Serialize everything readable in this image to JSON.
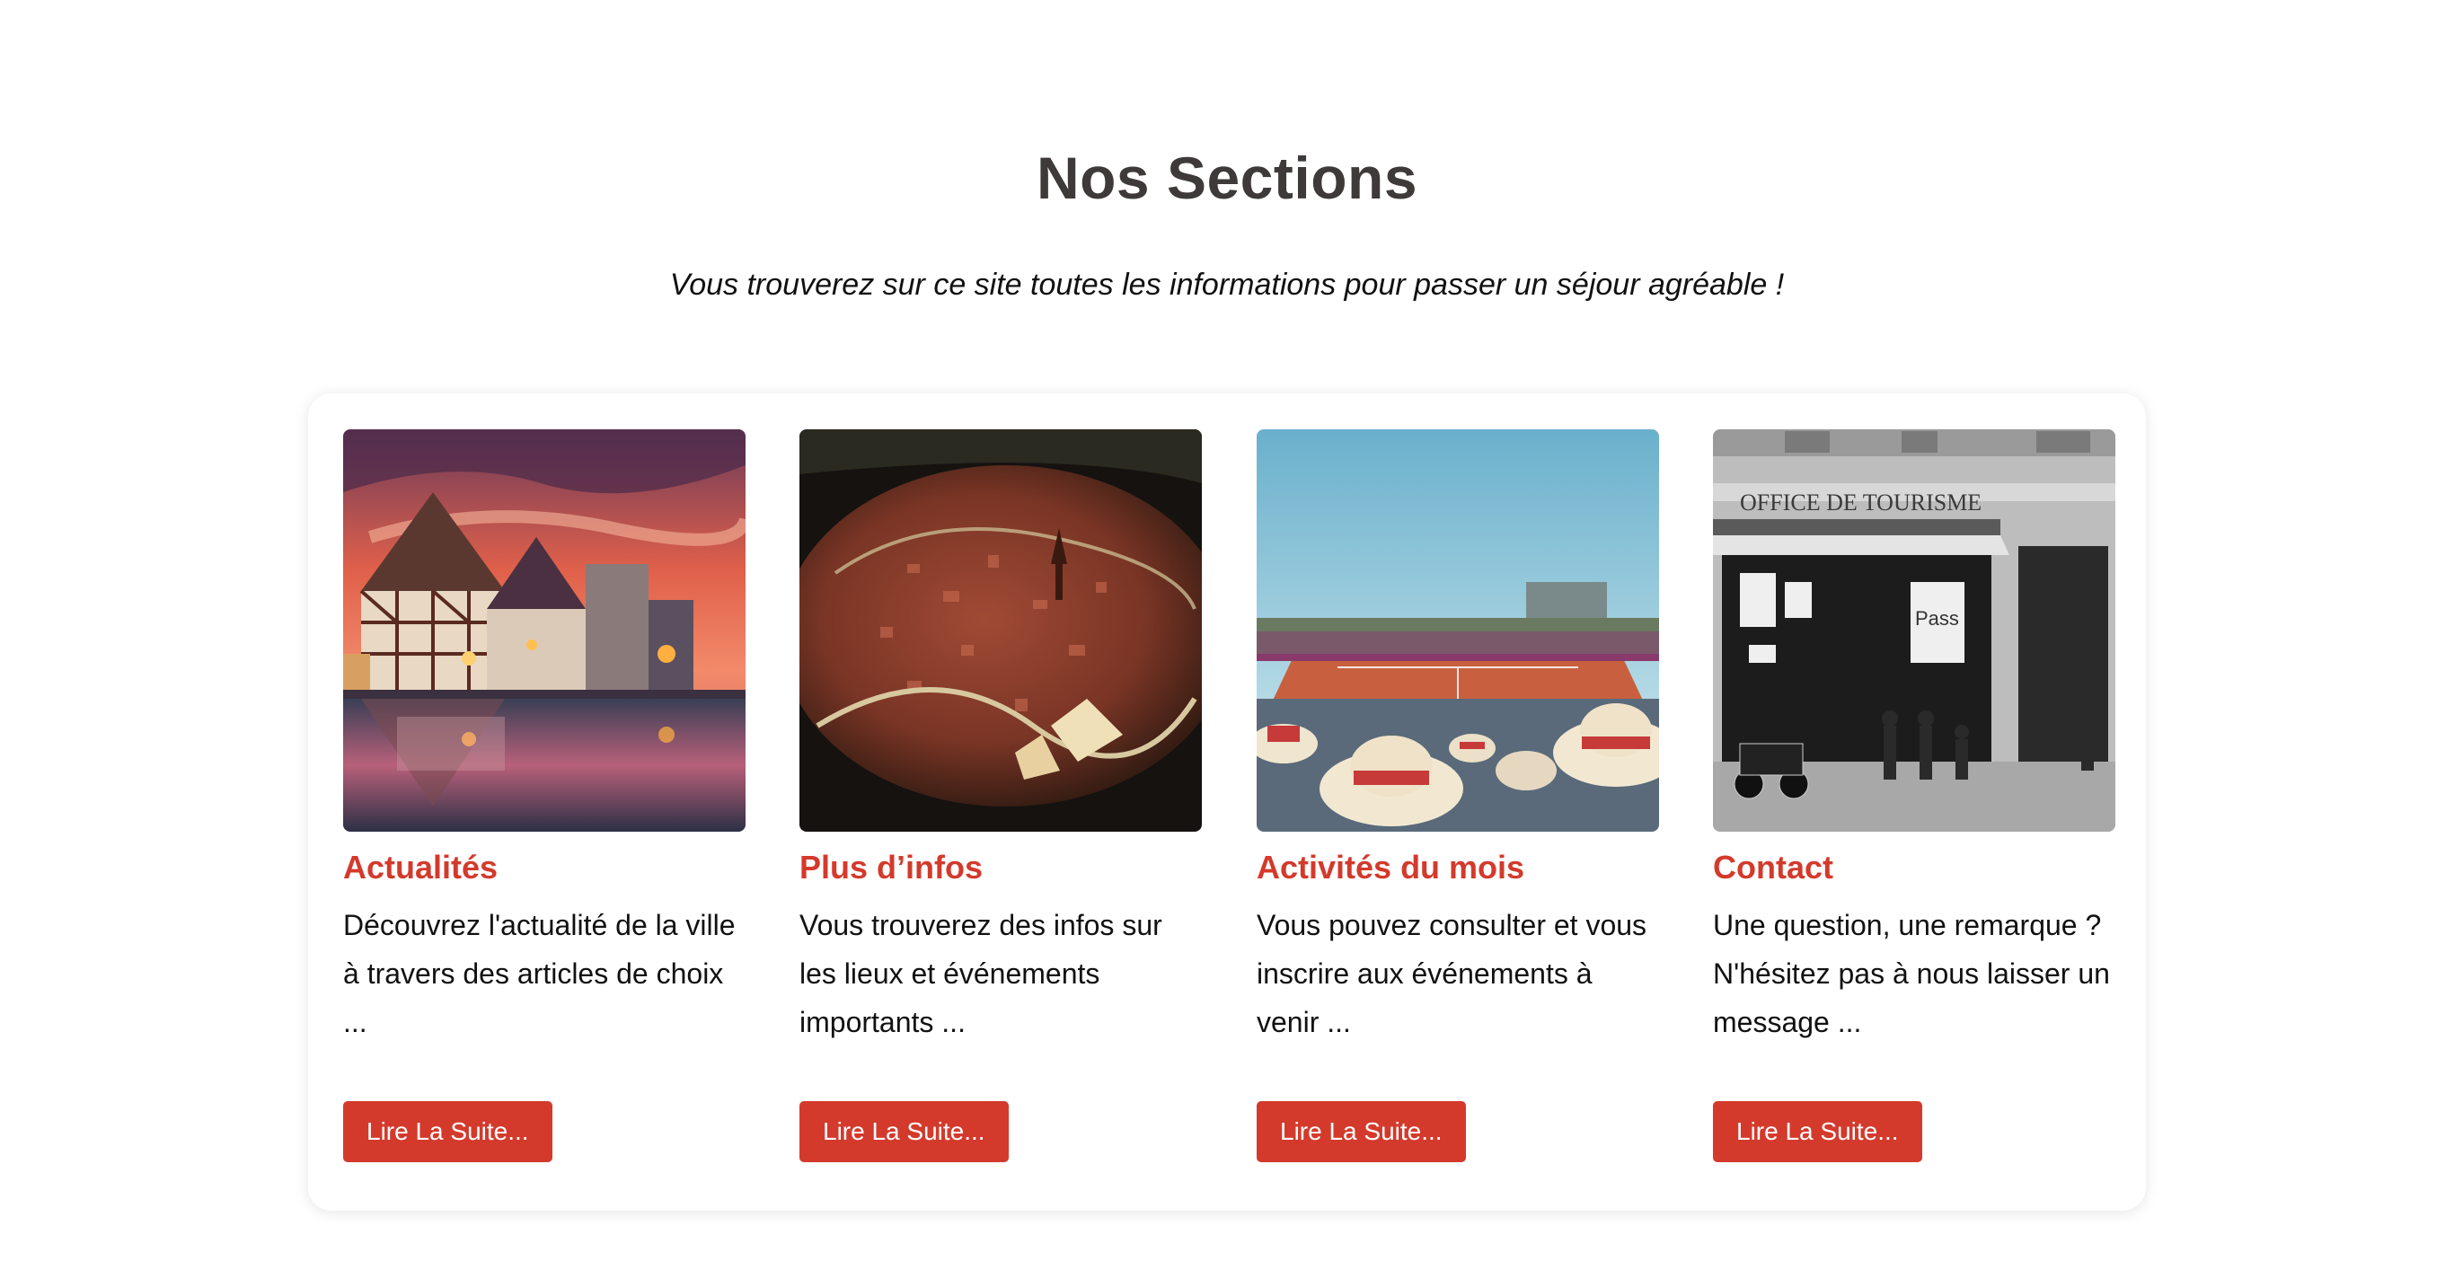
{
  "heading": {
    "title": "Nos Sections",
    "subtitle": "Vous trouverez sur ce site toutes les informations pour passer un séjour agréable !"
  },
  "colors": {
    "accent": "#d33a2c",
    "title_text": "#3d3a39",
    "body_text": "#111111",
    "background": "#ffffff"
  },
  "cards": [
    {
      "image": "strasbourg-petite-france-sunset-photo",
      "title": "Actualités",
      "text": "Découvrez l'actualité de la ville à travers des articles de choix ...",
      "button": "Lire La Suite..."
    },
    {
      "image": "city-relief-model-photo",
      "title": "Plus d’infos",
      "text": "Vous trouverez des infos sur les lieux et événements importants ...",
      "button": "Lire La Suite..."
    },
    {
      "image": "tennis-stadium-crowd-photo",
      "title": "Activités du mois",
      "text": "Vous pouvez consulter et vous inscrire aux événements à venir ...",
      "button": "Lire La Suite..."
    },
    {
      "image": "office-de-tourisme-storefront-photo",
      "title": "Contact",
      "text": "Une question, une remarque ? N'hésitez pas à nous laisser un message ...",
      "button": "Lire La Suite..."
    }
  ]
}
